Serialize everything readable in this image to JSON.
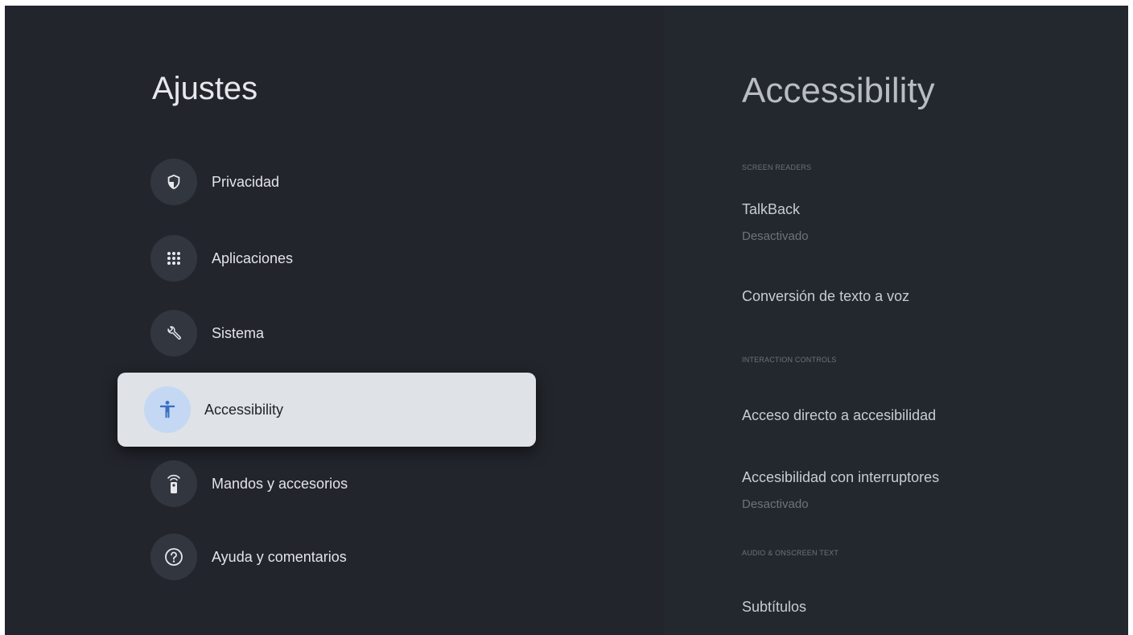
{
  "left": {
    "title": "Ajustes",
    "items": [
      {
        "label": "Privacidad",
        "icon": "shield-icon"
      },
      {
        "label": "Aplicaciones",
        "icon": "apps-grid-icon"
      },
      {
        "label": "Sistema",
        "icon": "wrench-icon"
      },
      {
        "label": "Accessibility",
        "icon": "accessibility-icon",
        "selected": true
      },
      {
        "label": "Mandos y accesorios",
        "icon": "remote-icon"
      },
      {
        "label": "Ayuda y comentarios",
        "icon": "help-icon"
      }
    ]
  },
  "right": {
    "title": "Accessibility",
    "sections": [
      {
        "header": "SCREEN READERS",
        "items": [
          {
            "label": "TalkBack",
            "sub": "Desactivado"
          },
          {
            "label": "Conversión de texto a voz"
          }
        ]
      },
      {
        "header": "INTERACTION CONTROLS",
        "items": [
          {
            "label": "Acceso directo a accesibilidad"
          },
          {
            "label": "Accesibilidad con interruptores",
            "sub": "Desactivado"
          }
        ]
      },
      {
        "header": "AUDIO & ONSCREEN TEXT",
        "items": [
          {
            "label": "Subtítulos"
          }
        ]
      }
    ]
  },
  "colors": {
    "background": "#22252c",
    "selected_bg": "#dfe2e6",
    "accent_icon": "#3b6fc4"
  }
}
